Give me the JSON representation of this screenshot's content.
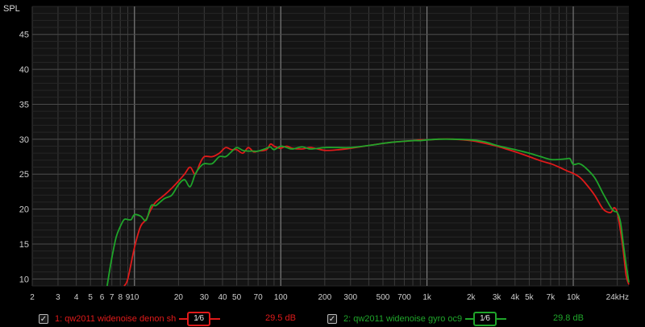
{
  "chart_data": {
    "type": "line",
    "ylabel": "SPL",
    "xscale": "log",
    "xlim": [
      2,
      24000
    ],
    "ylim": [
      9,
      49
    ],
    "xticks": [
      {
        "v": 2,
        "label": "2"
      },
      {
        "v": 3,
        "label": "3"
      },
      {
        "v": 4,
        "label": "4"
      },
      {
        "v": 5,
        "label": "5"
      },
      {
        "v": 6,
        "label": "6"
      },
      {
        "v": 7,
        "label": "7"
      },
      {
        "v": 8,
        "label": "8"
      },
      {
        "v": 9,
        "label": "9"
      },
      {
        "v": 10,
        "label": "10"
      },
      {
        "v": 20,
        "label": "20"
      },
      {
        "v": 30,
        "label": "30"
      },
      {
        "v": 40,
        "label": "40"
      },
      {
        "v": 50,
        "label": "50"
      },
      {
        "v": 70,
        "label": "70"
      },
      {
        "v": 100,
        "label": "100"
      },
      {
        "v": 200,
        "label": "200"
      },
      {
        "v": 300,
        "label": "300"
      },
      {
        "v": 500,
        "label": "500"
      },
      {
        "v": 700,
        "label": "700"
      },
      {
        "v": 1000,
        "label": "1k"
      },
      {
        "v": 2000,
        "label": "2k"
      },
      {
        "v": 3000,
        "label": "3k"
      },
      {
        "v": 4000,
        "label": "4k"
      },
      {
        "v": 5000,
        "label": "5k"
      },
      {
        "v": 7000,
        "label": "7k"
      },
      {
        "v": 10000,
        "label": "10k"
      },
      {
        "v": 24000,
        "label": "24kHz"
      }
    ],
    "yticks": [
      10,
      15,
      20,
      25,
      30,
      35,
      40,
      45
    ],
    "grid": true,
    "series": [
      {
        "name": "1: qw2011 widenoise denon sh",
        "color": "#e01a1a",
        "x": [
          8.5,
          9,
          10,
          11,
          12,
          13,
          14,
          16,
          18,
          20,
          22,
          24,
          26,
          28,
          30,
          34,
          38,
          42,
          46,
          50,
          55,
          60,
          65,
          70,
          80,
          85,
          90,
          95,
          100,
          110,
          120,
          140,
          160,
          200,
          250,
          300,
          400,
          500,
          600,
          700,
          800,
          900,
          1000,
          1200,
          1500,
          2000,
          2500,
          3000,
          4000,
          5000,
          6000,
          7000,
          8000,
          9000,
          10000,
          11000,
          12000,
          14000,
          16000,
          18000,
          19000,
          20000,
          21000,
          22000,
          23000,
          24000
        ],
        "y": [
          9,
          10,
          14.5,
          17.5,
          18.5,
          20,
          21,
          22,
          23,
          24,
          25,
          26,
          25,
          26.5,
          27.5,
          27.5,
          28,
          28.8,
          28.5,
          28.5,
          28,
          28.8,
          28.2,
          28.3,
          28.5,
          29.3,
          29,
          28.8,
          28.7,
          29,
          28.7,
          28.6,
          28.8,
          28.4,
          28.5,
          28.7,
          29.1,
          29.4,
          29.6,
          29.7,
          29.8,
          29.9,
          29.9,
          30,
          30,
          29.8,
          29.4,
          29,
          28.2,
          27.5,
          26.9,
          26.5,
          26,
          25.5,
          25.1,
          24.6,
          23.8,
          22,
          20,
          19.5,
          20.2,
          19.5,
          17,
          14,
          10.5,
          9.2
        ]
      },
      {
        "name": "2: qw2011 widenoise gyro oc9",
        "color": "#1fa52a",
        "x": [
          6.5,
          7,
          7.5,
          8,
          8.5,
          9,
          9.5,
          10,
          11,
          12,
          13,
          14,
          16,
          18,
          20,
          22,
          24,
          26,
          28,
          30,
          34,
          38,
          42,
          46,
          50,
          55,
          60,
          65,
          70,
          80,
          85,
          90,
          100,
          110,
          120,
          140,
          160,
          200,
          250,
          300,
          400,
          500,
          600,
          700,
          800,
          900,
          1000,
          1200,
          1500,
          2000,
          2500,
          3000,
          4000,
          5000,
          6000,
          7000,
          8000,
          9000,
          9500,
          10000,
          11000,
          12000,
          14000,
          16000,
          18000,
          19000,
          20000,
          21000,
          22000,
          23000,
          24000
        ],
        "y": [
          9,
          13,
          16,
          17.5,
          18.5,
          18.5,
          18.5,
          19.2,
          19,
          18.4,
          20.5,
          20.5,
          21.5,
          22,
          23.5,
          24.2,
          23.2,
          25,
          26,
          26.5,
          26.5,
          27.5,
          27.5,
          28.2,
          28.8,
          28.4,
          28.3,
          28.3,
          28.3,
          28.7,
          28.9,
          28.5,
          29,
          28.8,
          28.6,
          28.9,
          28.6,
          28.8,
          28.8,
          28.8,
          29.1,
          29.4,
          29.6,
          29.7,
          29.8,
          29.8,
          29.9,
          30,
          30,
          29.9,
          29.6,
          29.1,
          28.5,
          28,
          27.5,
          27.1,
          27.1,
          27.2,
          27.2,
          26.4,
          26.5,
          26,
          24.5,
          22.2,
          20.3,
          19.7,
          19.5,
          18.2,
          15,
          12,
          9.5
        ]
      }
    ]
  },
  "legend": [
    {
      "checked": "✓",
      "name": "1: qw2011 widenoise denon sh",
      "smoothing": "1⁄6",
      "level": "29.5 dB",
      "color": "#e01a1a"
    },
    {
      "checked": "✓",
      "name": "2: qw2011 widenoise gyro oc9",
      "smoothing": "1⁄6",
      "level": "29.8 dB",
      "color": "#1fa52a"
    }
  ]
}
